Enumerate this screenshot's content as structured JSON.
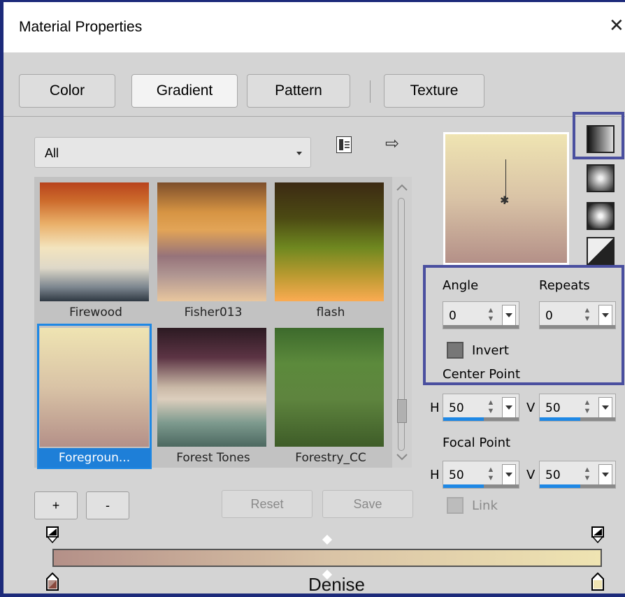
{
  "window": {
    "title": "Material Properties",
    "close_glyph": "✕"
  },
  "tabs": [
    {
      "label": "Color",
      "active": false
    },
    {
      "label": "Gradient",
      "active": true
    },
    {
      "label": "Pattern",
      "active": false
    },
    {
      "label": "Texture",
      "active": false
    }
  ],
  "library": {
    "category": "All",
    "items": [
      {
        "label": "Firewood",
        "selected": false
      },
      {
        "label": "Fisher013",
        "selected": false
      },
      {
        "label": "flash",
        "selected": false
      },
      {
        "label": "Foregroun...",
        "selected": true
      },
      {
        "label": "Forest Tones",
        "selected": false
      },
      {
        "label": "Forestry_CC",
        "selected": false
      }
    ]
  },
  "buttons": {
    "add": "+",
    "remove": "-",
    "reset": "Reset",
    "save": "Save"
  },
  "properties": {
    "angle_label": "Angle",
    "angle_value": "0",
    "repeats_label": "Repeats",
    "repeats_value": "0",
    "invert_label": "Invert",
    "center_point_label": "Center Point",
    "center_h_prefix": "H",
    "center_h_value": "50",
    "center_v_prefix": "V",
    "center_v_value": "50",
    "focal_point_label": "Focal Point",
    "focal_h_prefix": "H",
    "focal_h_value": "50",
    "focal_v_prefix": "V",
    "focal_v_value": "50",
    "link_label": "Link"
  },
  "gradient_editor": {
    "start_color": "#b49088",
    "end_color": "#efe4b2"
  },
  "watermark": "Denise",
  "colors": {
    "selection": "#1e88e5",
    "highlight": "#4a4f9f",
    "frame": "#1c2a7a"
  }
}
